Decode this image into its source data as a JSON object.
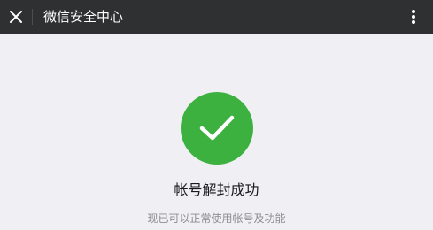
{
  "header": {
    "title": "微信安全中心",
    "close_icon": "close-icon",
    "more_icon": "more-vertical-icon",
    "background_color": "#2e3032"
  },
  "result": {
    "icon": "checkmark-icon",
    "icon_color": "#3db13f",
    "title": "帐号解封成功",
    "subtitle": "现已可以正常使用帐号及功能"
  },
  "page": {
    "background_color": "#efeff4"
  }
}
